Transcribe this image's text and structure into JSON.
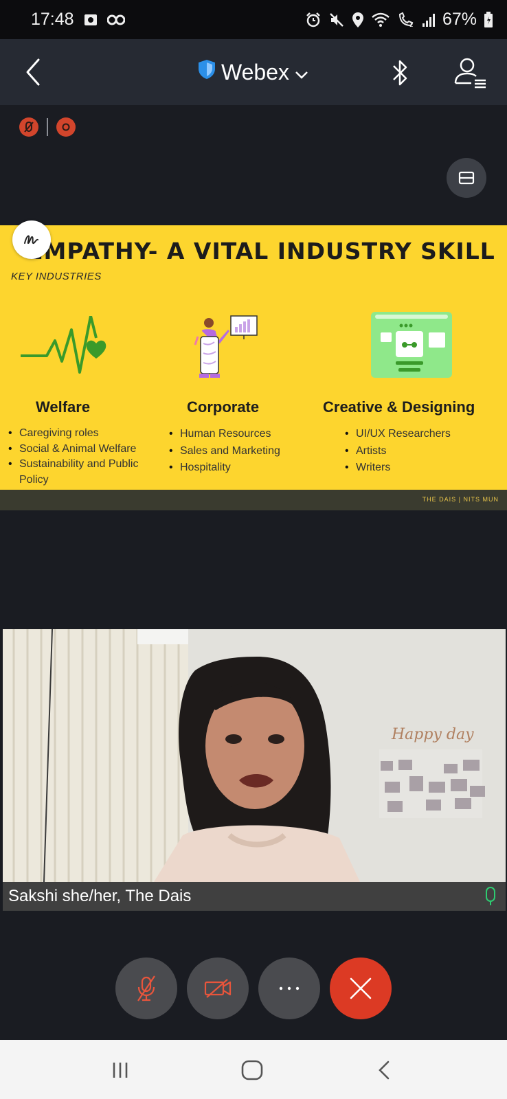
{
  "status_bar": {
    "time": "17:48",
    "battery": "67%",
    "icons": [
      "camera-status-icon",
      "recorder-status-icon",
      "alarm-icon",
      "mute-icon",
      "location-icon",
      "wifi-icon",
      "wifi-calling-icon",
      "signal-icon",
      "battery-icon"
    ]
  },
  "header": {
    "title": "Webex",
    "icons": [
      "back-icon",
      "shield-icon",
      "chevron-down-icon",
      "bluetooth-icon",
      "participants-icon"
    ]
  },
  "recording": {
    "icons": [
      "recording-icon",
      "record-stop-icon"
    ]
  },
  "slide": {
    "title": "EMPATHY- A VITAL INDUSTRY SKILL",
    "subtitle": "KEY INDUSTRIES",
    "columns": [
      {
        "heading": "Welfare",
        "items": [
          "Caregiving roles",
          "Social & Animal Welfare",
          "Sustainability and Public Policy"
        ]
      },
      {
        "heading": "Corporate",
        "items": [
          "Human Resources",
          "Sales and Marketing",
          "Hospitality"
        ]
      },
      {
        "heading": "Creative & Designing",
        "items": [
          "UI/UX Researchers",
          "Artists",
          " Writers"
        ]
      }
    ],
    "footer": "THE DAIS | NITS MUN",
    "colors": {
      "background": "#fdd52e",
      "accent_green": "#3a9a2a"
    }
  },
  "video": {
    "participant_name": "Sakshi she/her, The Dais",
    "mic_state": "unmuted"
  },
  "controls": {
    "buttons": [
      "mute-mic",
      "stop-video",
      "more",
      "leave-meeting"
    ],
    "colors": {
      "leave": "#dc3a24",
      "default": "#4a4b4f"
    }
  },
  "nav_bar": {
    "buttons": [
      "recents",
      "home",
      "back"
    ]
  }
}
